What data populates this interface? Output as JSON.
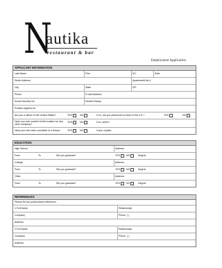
{
  "logo": {
    "letter": "N",
    "rest": "autika",
    "tagline": "restaurant & bar"
  },
  "form_title": "Employment Application",
  "applicant": {
    "header": "APPLICANT INFORMATION",
    "last_name": "Last Name",
    "first": "First",
    "mi": "M.I.",
    "date": "Date",
    "street": "Street Address",
    "apartment": "Apartment/Unit #",
    "city": "City",
    "state": "State",
    "zip": "ZIP",
    "phone": "Phone",
    "email": "E-mail Address",
    "ssn": "Social Security No.",
    "salary": "Desired Salary",
    "position": "Position Applied for:",
    "citizen_q": "Are you a citizen of the United States?",
    "authorized_q": "If no, are you authorized to work in the U.S.?",
    "worked_q": "Have you ever worked at this location for any other company?",
    "when_q": "If so, when?",
    "felony_q": "Have you ever been convicted of a felony?",
    "explain": "If yes, explain"
  },
  "education": {
    "header": "EDUCATION",
    "high_school": "High School",
    "college": "College",
    "other": "Other",
    "address": "Address",
    "from": "From",
    "to": "To",
    "graduate_q": "Did you graduate?",
    "degree": "Degree"
  },
  "references": {
    "header": "REFERENCES",
    "note": "Please list two professional references.",
    "full_name_1": "1.Full Name",
    "full_name_2": "2.Full Name",
    "relationship": "Relationship",
    "company": "Company",
    "phone": "Phone",
    "phone_format": "(        )",
    "address": "Address"
  },
  "yes": "YES",
  "no": "NO"
}
